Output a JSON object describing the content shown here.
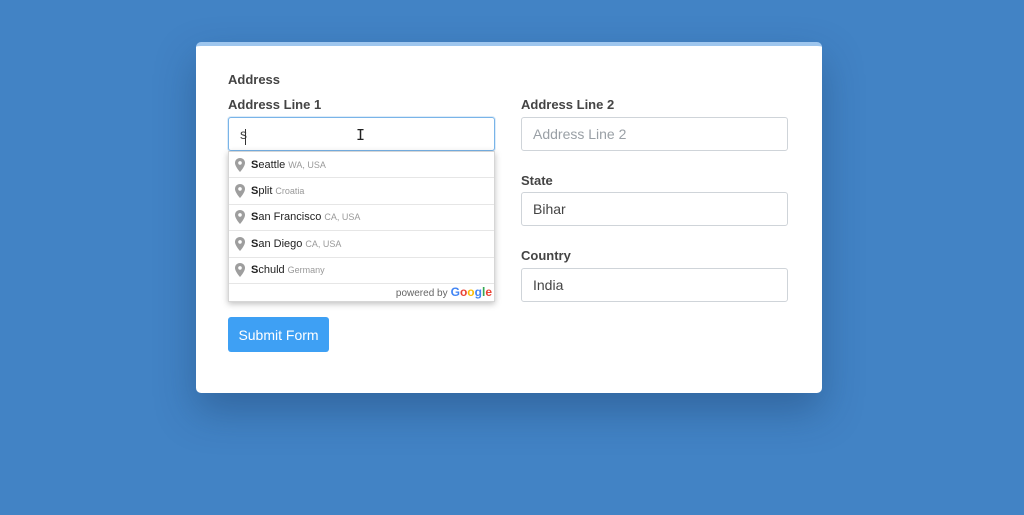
{
  "form": {
    "section_title": "Address",
    "address_line_1": {
      "label": "Address Line 1",
      "value": "s"
    },
    "address_line_2": {
      "label": "Address Line 2",
      "placeholder": "Address Line 2",
      "value": ""
    },
    "state": {
      "label": "State",
      "value": "Bihar"
    },
    "country": {
      "label": "Country",
      "value": "India"
    },
    "submit_label": "Submit Form"
  },
  "autocomplete": {
    "suggestions": [
      {
        "match": "S",
        "rest": "eattle",
        "secondary": "WA, USA"
      },
      {
        "match": "S",
        "rest": "plit",
        "secondary": "Croatia"
      },
      {
        "match": "S",
        "rest": "an Francisco",
        "secondary": "CA, USA"
      },
      {
        "match": "S",
        "rest": "an Diego",
        "secondary": "CA, USA"
      },
      {
        "match": "S",
        "rest": "chuld",
        "secondary": "Germany"
      }
    ],
    "powered_by": "powered by",
    "provider": {
      "letters": [
        "G",
        "o",
        "o",
        "g",
        "l",
        "e"
      ],
      "colors": [
        "#4285F4",
        "#EA4335",
        "#FBBC05",
        "#4285F4",
        "#34A853",
        "#EA4335"
      ]
    }
  },
  "colors": {
    "background": "#4283c5",
    "submit_button": "#3ea0f4",
    "pin_icon": "#9e9e9e"
  },
  "icons": {
    "suggestion_icon": "map-pin-icon",
    "cursor": "text-cursor-icon"
  }
}
